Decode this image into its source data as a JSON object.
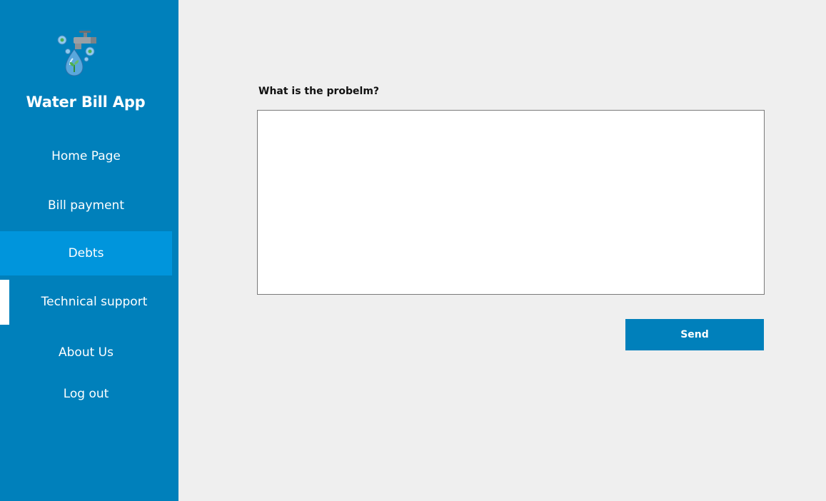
{
  "sidebar": {
    "app_title": "Water Bill App",
    "logo_icon": "water-faucet-drop-icon",
    "items": [
      {
        "label": "Home Page"
      },
      {
        "label": "Bill payment"
      },
      {
        "label": "Debts"
      },
      {
        "label": "Technical support"
      },
      {
        "label": "About Us"
      },
      {
        "label": "Log out"
      }
    ],
    "active_highlight": "Debts",
    "selected_indicator": "Technical support"
  },
  "main": {
    "question_label": "What is the probelm?",
    "problem_text": "",
    "send_label": "Send"
  },
  "colors": {
    "sidebar_bg": "#0080bb",
    "active_item_bg": "#0095dc",
    "page_bg": "#efefef",
    "button_bg": "#0080bb"
  }
}
